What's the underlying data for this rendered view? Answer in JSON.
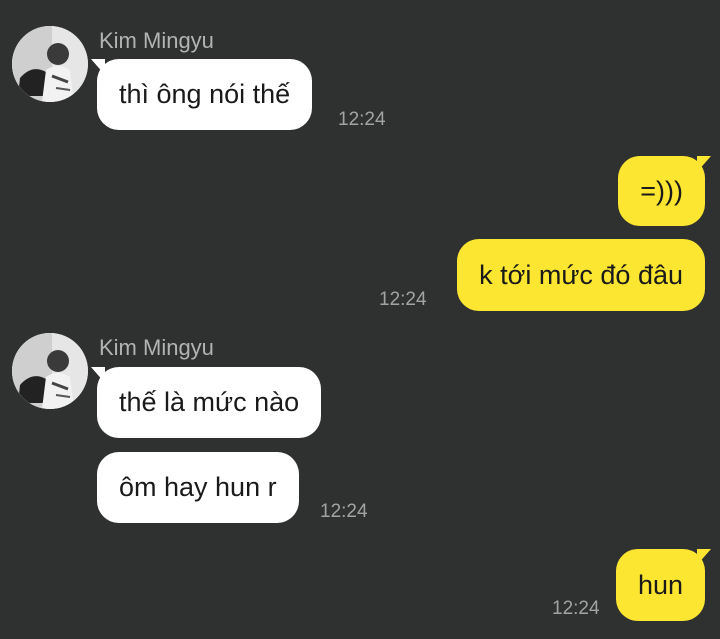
{
  "contact": {
    "name": "Kim Mingyu",
    "avatar_icon": "profile-photo"
  },
  "colors": {
    "background": "#2f3030",
    "incoming_bubble": "#ffffff",
    "outgoing_bubble": "#fde631",
    "timestamp": "#a3a3a3",
    "sender_name": "#b3b3b3"
  },
  "messages": [
    {
      "direction": "in",
      "text": "thì ông nói thế",
      "time": "12:24"
    },
    {
      "direction": "out",
      "text": "=)))",
      "time": ""
    },
    {
      "direction": "out",
      "text": "k tới mức đó đâu",
      "time": "12:24"
    },
    {
      "direction": "in",
      "text": "thế là mức nào",
      "time": ""
    },
    {
      "direction": "in",
      "text": "ôm hay hun r",
      "time": "12:24"
    },
    {
      "direction": "out",
      "text": "hun",
      "time": "12:24"
    }
  ]
}
